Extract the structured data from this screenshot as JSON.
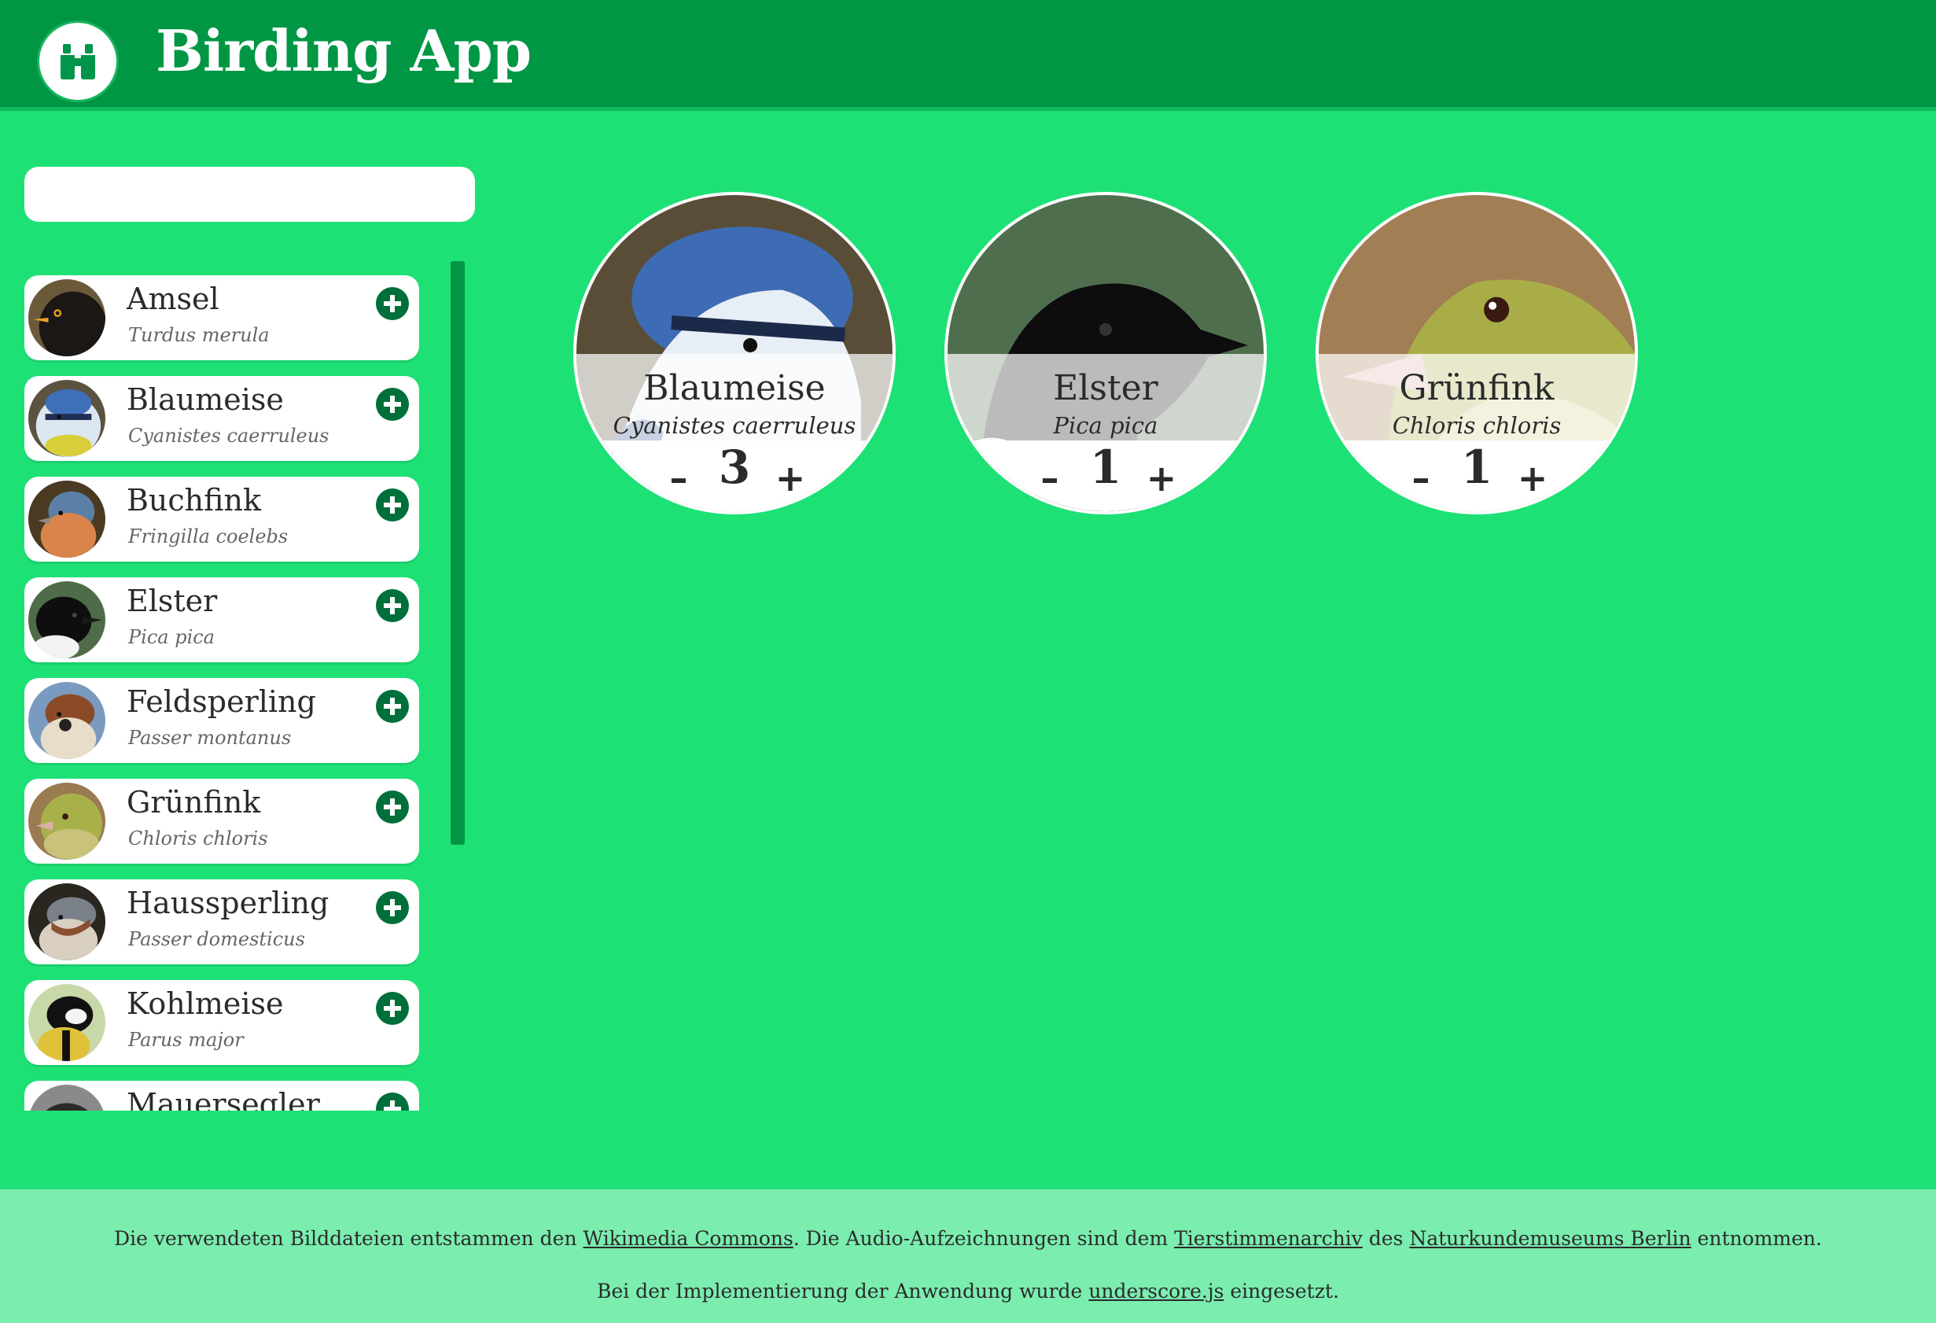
{
  "app": {
    "title": "Birding App",
    "logo_icon": "binoculars-icon"
  },
  "search": {
    "placeholder": "",
    "value": ""
  },
  "sidebar": {
    "items": [
      {
        "name": "Amsel",
        "latin": "Turdus merula",
        "photo": "amsel"
      },
      {
        "name": "Blaumeise",
        "latin": "Cyanistes caerruleus",
        "photo": "blaumeise"
      },
      {
        "name": "Buchfink",
        "latin": "Fringilla coelebs",
        "photo": "buchfink"
      },
      {
        "name": "Elster",
        "latin": "Pica pica",
        "photo": "elster"
      },
      {
        "name": "Feldsperling",
        "latin": "Passer montanus",
        "photo": "feldsperling"
      },
      {
        "name": "Grünfink",
        "latin": "Chloris chloris",
        "photo": "gruenfink"
      },
      {
        "name": "Haussperling",
        "latin": "Passer domesticus",
        "photo": "haussperling"
      },
      {
        "name": "Kohlmeise",
        "latin": "Parus major",
        "photo": "kohlmeise"
      },
      {
        "name": "Mauersegler",
        "latin": "",
        "photo": "mauersegler"
      }
    ],
    "add_icon": "plus-circle-icon"
  },
  "cards": [
    {
      "name": "Blaumeise",
      "latin": "Cyanistes caerruleus",
      "count": "3",
      "minus": "–",
      "plus": "+"
    },
    {
      "name": "Elster",
      "latin": "Pica pica",
      "count": "1",
      "minus": "–",
      "plus": "+"
    },
    {
      "name": "Grünfink",
      "latin": "Chloris chloris",
      "count": "1",
      "minus": "–",
      "plus": "+"
    }
  ],
  "footer": {
    "line1_a": "Die verwendeten Bilddateien entstammen den ",
    "link_wikimedia": "Wikimedia Commons",
    "line1_b": ". Die Audio-Aufzeichnungen sind dem ",
    "link_tierstimmen": "Tierstimmenarchiv",
    "line1_c": " des ",
    "link_museum": "Naturkundemuseums Berlin",
    "line1_d": " entnommen.",
    "line2_a": "Bei der Implementierung der Anwendung wurde ",
    "link_underscore": "underscore.js",
    "line2_b": " eingesetzt."
  },
  "colors": {
    "background": "#1ee176",
    "header": "#009644",
    "accent_dark": "#00703a",
    "footer": "#7aedaf"
  }
}
